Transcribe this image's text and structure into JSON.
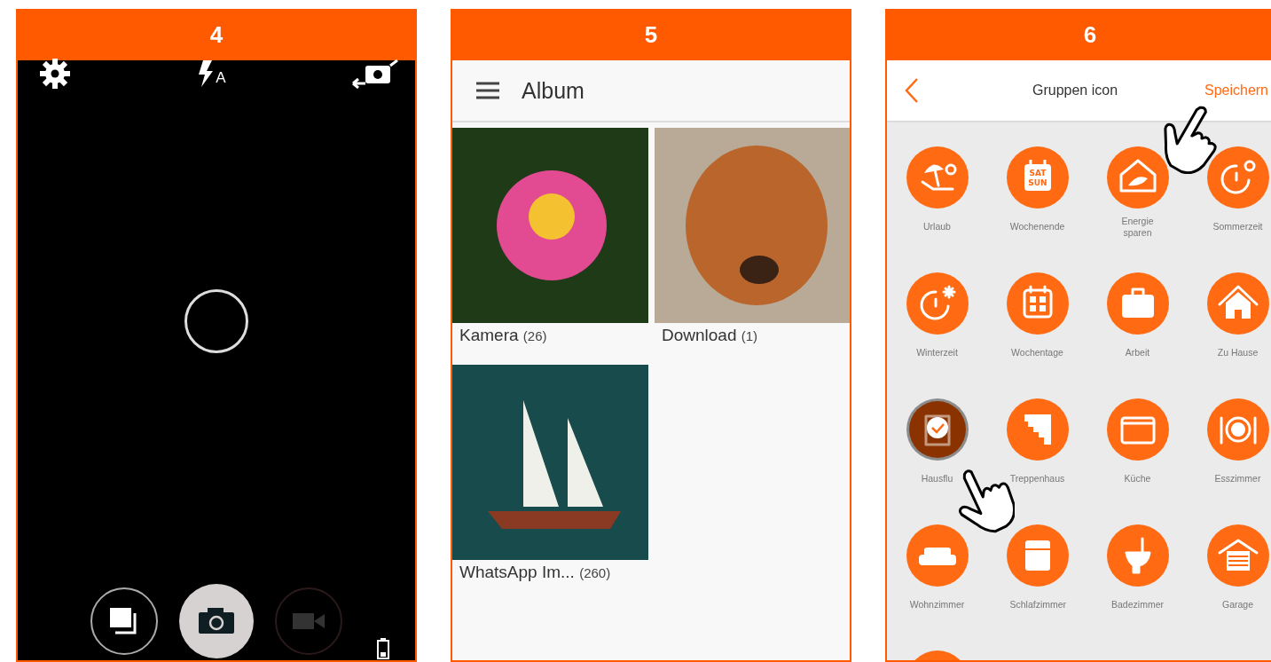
{
  "panels": [
    {
      "kind": "camera",
      "number": "4",
      "flash_mode": "A",
      "modes": [
        {
          "kind": "gallery",
          "selected": false,
          "disabled": false
        },
        {
          "kind": "photo",
          "selected": true,
          "disabled": false
        },
        {
          "kind": "video",
          "selected": false,
          "disabled": true
        }
      ]
    },
    {
      "kind": "album",
      "number": "5",
      "title": "Album",
      "albums": [
        {
          "name": "Kamera",
          "count": "(26)",
          "kind": "flower"
        },
        {
          "name": "Download",
          "count": "(1)",
          "kind": "puppy"
        },
        {
          "name": "WhatsApp Im...",
          "count": "(260)",
          "kind": "sailboat"
        }
      ]
    },
    {
      "kind": "icons",
      "number": "6",
      "title": "Gruppen icon",
      "save": "Speichern",
      "icons": [
        {
          "kind": "beach",
          "label": "Urlaub",
          "selected": false
        },
        {
          "kind": "weekend",
          "label": "Wochenende",
          "badge": [
            "SAT",
            "SUN"
          ],
          "selected": false
        },
        {
          "kind": "ecohouse",
          "label": "Energie sparen",
          "selected": false
        },
        {
          "kind": "summer",
          "label": "Sommerzeit",
          "selected": false
        },
        {
          "kind": "winter",
          "label": "Winterzeit",
          "selected": false
        },
        {
          "kind": "calendar",
          "label": "Wochentage",
          "selected": false
        },
        {
          "kind": "suitcase",
          "label": "Arbeit",
          "selected": false
        },
        {
          "kind": "house",
          "label": "Zu Hause",
          "selected": false
        },
        {
          "kind": "hall",
          "label": "Hausflu",
          "selected": true
        },
        {
          "kind": "stairs",
          "label": "Treppenhaus",
          "selected": false
        },
        {
          "kind": "oven",
          "label": "Küche",
          "selected": false
        },
        {
          "kind": "dining",
          "label": "Esszimmer",
          "selected": false
        },
        {
          "kind": "sofa",
          "label": "Wohnzimmer",
          "selected": false
        },
        {
          "kind": "bed",
          "label": "Schlafzimmer",
          "selected": false
        },
        {
          "kind": "toilet",
          "label": "Badezimmer",
          "selected": false
        },
        {
          "kind": "garage",
          "label": "Garage",
          "selected": false
        },
        {
          "kind": "blank",
          "selected": false
        }
      ]
    }
  ]
}
